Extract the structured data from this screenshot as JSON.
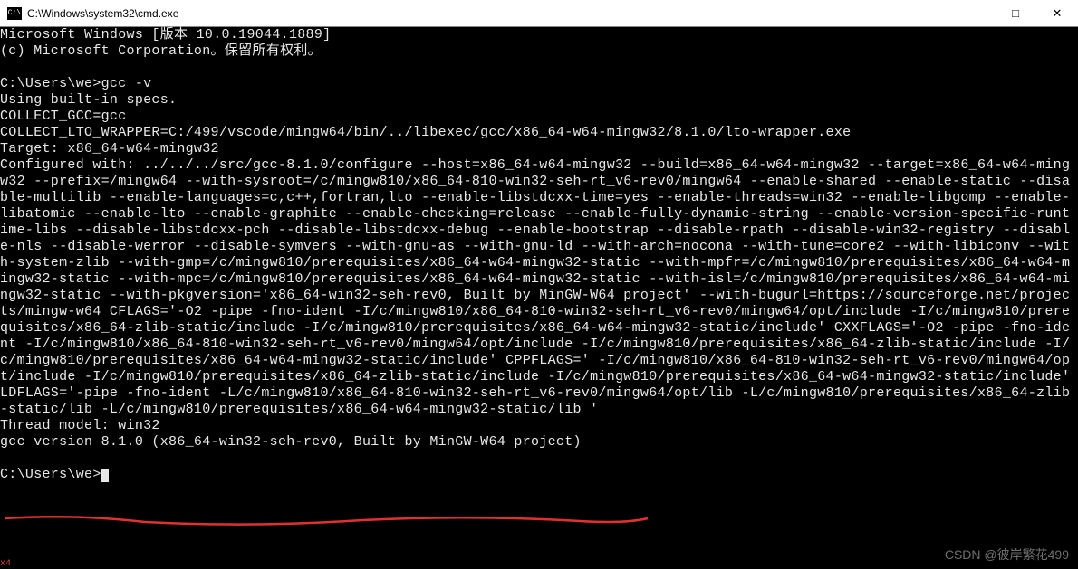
{
  "titlebar": {
    "path": "C:\\Windows\\system32\\cmd.exe"
  },
  "controls": {
    "minimize": "—",
    "maximize": "□",
    "close": "✕"
  },
  "terminal": {
    "line1": "Microsoft Windows [版本 10.0.19044.1889]",
    "line2": "(c) Microsoft Corporation。保留所有权利。",
    "blank1": "",
    "prompt1": "C:\\Users\\we>gcc -v",
    "line3": "Using built-in specs.",
    "line4": "COLLECT_GCC=gcc",
    "line5": "COLLECT_LTO_WRAPPER=C:/499/vscode/mingw64/bin/../libexec/gcc/x86_64-w64-mingw32/8.1.0/lto-wrapper.exe",
    "line6": "Target: x86_64-w64-mingw32",
    "line7": "Configured with: ../../../src/gcc-8.1.0/configure --host=x86_64-w64-mingw32 --build=x86_64-w64-mingw32 --target=x86_64-w64-mingw32 --prefix=/mingw64 --with-sysroot=/c/mingw810/x86_64-810-win32-seh-rt_v6-rev0/mingw64 --enable-shared --enable-static --disable-multilib --enable-languages=c,c++,fortran,lto --enable-libstdcxx-time=yes --enable-threads=win32 --enable-libgomp --enable-libatomic --enable-lto --enable-graphite --enable-checking=release --enable-fully-dynamic-string --enable-version-specific-runtime-libs --disable-libstdcxx-pch --disable-libstdcxx-debug --enable-bootstrap --disable-rpath --disable-win32-registry --disable-nls --disable-werror --disable-symvers --with-gnu-as --with-gnu-ld --with-arch=nocona --with-tune=core2 --with-libiconv --with-system-zlib --with-gmp=/c/mingw810/prerequisites/x86_64-w64-mingw32-static --with-mpfr=/c/mingw810/prerequisites/x86_64-w64-mingw32-static --with-mpc=/c/mingw810/prerequisites/x86_64-w64-mingw32-static --with-isl=/c/mingw810/prerequisites/x86_64-w64-mingw32-static --with-pkgversion='x86_64-win32-seh-rev0, Built by MinGW-W64 project' --with-bugurl=https://sourceforge.net/projects/mingw-w64 CFLAGS='-O2 -pipe -fno-ident -I/c/mingw810/x86_64-810-win32-seh-rt_v6-rev0/mingw64/opt/include -I/c/mingw810/prerequisites/x86_64-zlib-static/include -I/c/mingw810/prerequisites/x86_64-w64-mingw32-static/include' CXXFLAGS='-O2 -pipe -fno-ident -I/c/mingw810/x86_64-810-win32-seh-rt_v6-rev0/mingw64/opt/include -I/c/mingw810/prerequisites/x86_64-zlib-static/include -I/c/mingw810/prerequisites/x86_64-w64-mingw32-static/include' CPPFLAGS=' -I/c/mingw810/x86_64-810-win32-seh-rt_v6-rev0/mingw64/opt/include -I/c/mingw810/prerequisites/x86_64-zlib-static/include -I/c/mingw810/prerequisites/x86_64-w64-mingw32-static/include' LDFLAGS='-pipe -fno-ident -L/c/mingw810/x86_64-810-win32-seh-rt_v6-rev0/mingw64/opt/lib -L/c/mingw810/prerequisites/x86_64-zlib-static/lib -L/c/mingw810/prerequisites/x86_64-w64-mingw32-static/lib '",
    "line8": "Thread model: win32",
    "line9": "gcc version 8.1.0 (x86_64-win32-seh-rev0, Built by MinGW-W64 project)",
    "blank2": "",
    "prompt2": "C:\\Users\\we>"
  },
  "watermark": "CSDN @彼岸繁花499",
  "editor_tag": "x4"
}
